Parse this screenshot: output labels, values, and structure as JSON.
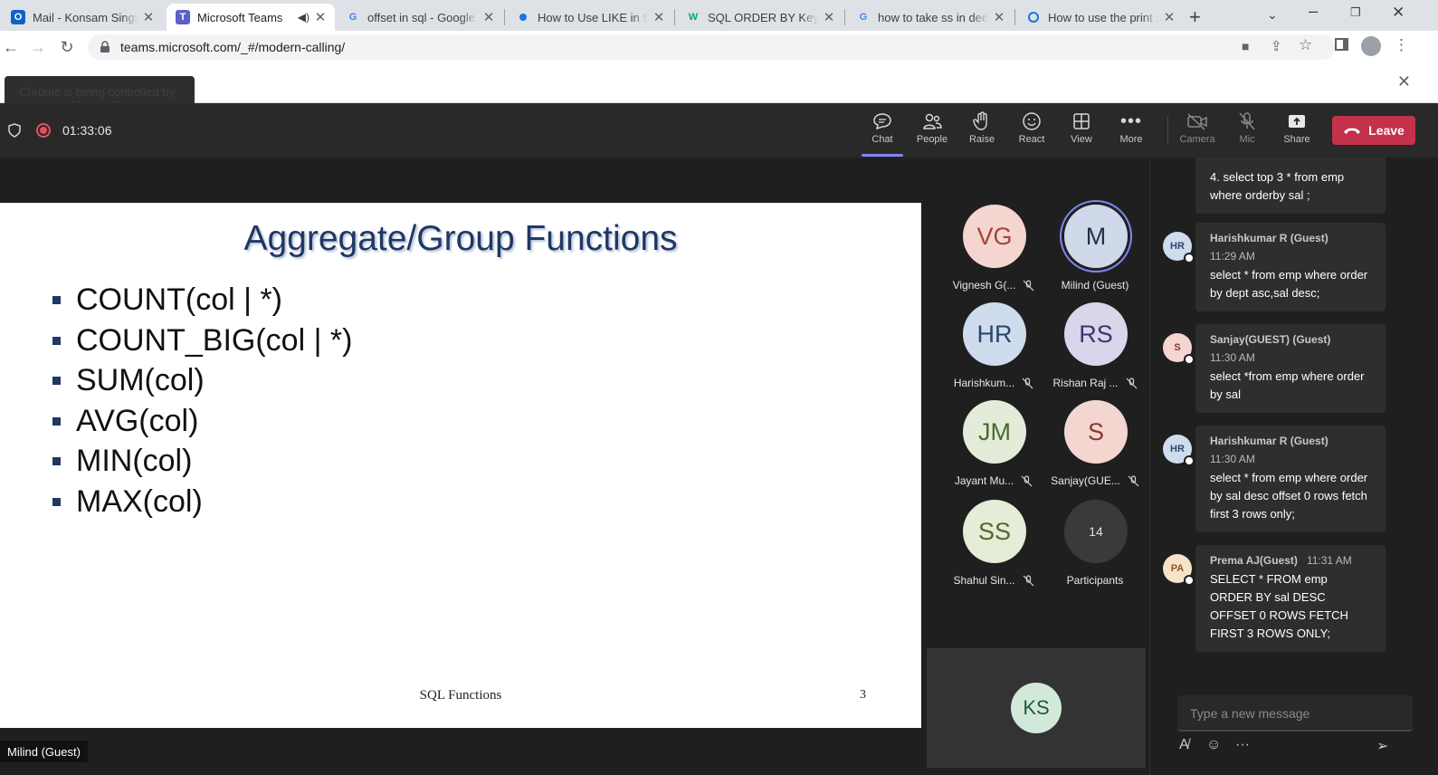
{
  "browser": {
    "tabs": [
      {
        "title": "Mail - Konsam Singh - Outlook",
        "favicon": "outlook-icon",
        "active": false
      },
      {
        "title": "Microsoft Teams",
        "favicon": "teams-icon",
        "active": true
      },
      {
        "title": "offset in sql - Google Search",
        "favicon": "google-icon",
        "active": false
      },
      {
        "title": "How to Use LIKE in SQL",
        "favicon": "dot-icon",
        "active": false
      },
      {
        "title": "SQL ORDER BY Keyword",
        "favicon": "w3schools-icon",
        "active": false
      },
      {
        "title": "how to take ss in deel laptop",
        "favicon": "google-icon",
        "active": false
      },
      {
        "title": "How to use the print screen",
        "favicon": "edge-icon",
        "active": false
      }
    ],
    "url": "teams.microsoft.com/_#/modern-calling/",
    "infobar": "Chrome is being controlled by automated test software."
  },
  "call": {
    "timer": "01:33:06",
    "controls": [
      {
        "label": "Chat",
        "icon": "chat-icon"
      },
      {
        "label": "People",
        "icon": "people-icon"
      },
      {
        "label": "Raise",
        "icon": "raise-hand-icon"
      },
      {
        "label": "React",
        "icon": "react-icon"
      },
      {
        "label": "View",
        "icon": "view-icon"
      },
      {
        "label": "More",
        "icon": "more-icon"
      },
      {
        "label": "Camera",
        "icon": "camera-off-icon"
      },
      {
        "label": "Mic",
        "icon": "mic-off-icon"
      },
      {
        "label": "Share",
        "icon": "share-icon"
      }
    ],
    "leave_label": "Leave"
  },
  "slide": {
    "title": "Aggregate/Group Functions",
    "bullets": [
      "COUNT(col | *)",
      "COUNT_BIG(col | *)",
      "SUM(col)",
      "AVG(col)",
      "MIN(col)",
      "MAX(col)"
    ],
    "footer": "SQL Functions",
    "page": "3"
  },
  "participants": [
    {
      "initials": "VG",
      "name": "Vignesh G(...",
      "muted": true,
      "bg": "#f5d5cf",
      "fg": "#a2453a"
    },
    {
      "initials": "M",
      "name": "Milind (Guest)",
      "muted": false,
      "bg": "#cfd9ea",
      "fg": "#22324d",
      "speaking": true
    },
    {
      "initials": "HR",
      "name": "Harishkum...",
      "muted": true,
      "bg": "#cfdcee",
      "fg": "#2c466d"
    },
    {
      "initials": "RS",
      "name": "Rishan Raj ...",
      "muted": true,
      "bg": "#d9d6ec",
      "fg": "#3b3770"
    },
    {
      "initials": "JM",
      "name": "Jayant Mu...",
      "muted": true,
      "bg": "#e3ecd9",
      "fg": "#4c6a2c"
    },
    {
      "initials": "S",
      "name": "Sanjay(GUE...",
      "muted": true,
      "bg": "#f3d6d0",
      "fg": "#8a3a2e"
    },
    {
      "initials": "SS",
      "name": "Shahul Sin...",
      "muted": true,
      "bg": "#e5ecd7",
      "fg": "#4f6a2a"
    },
    {
      "initials": "14",
      "name": "Participants",
      "muted": false,
      "bg": "#3a3a3a",
      "fg": "#e0e0e0"
    }
  ],
  "self": {
    "initials": "KS"
  },
  "speaker_badge": "Milind (Guest)",
  "chat": {
    "messages": [
      {
        "author": "",
        "time": "",
        "body": "4. select top 3 * from emp where orderby sal ;",
        "avatar": ""
      },
      {
        "author": "Harishkumar R (Guest)",
        "time": "11:29 AM",
        "body": "select * from emp where order by dept asc,sal desc;",
        "avatar": "HR"
      },
      {
        "author": "Sanjay(GUEST) (Guest)",
        "time": "11:30 AM",
        "body": "select *from emp where order by sal",
        "avatar": "S"
      },
      {
        "author": "Harishkumar R (Guest)",
        "time": "11:30 AM",
        "body": "select * from emp where order by sal desc offset 0 rows fetch first 3 rows only;",
        "avatar": "HR"
      },
      {
        "author": "Prema AJ(Guest)",
        "time": "11:31 AM",
        "body": "SELECT * FROM emp ORDER BY sal DESC OFFSET 0 ROWS FETCH FIRST 3 ROWS ONLY;",
        "avatar": "PA"
      }
    ],
    "compose_placeholder": "Type a new message"
  }
}
